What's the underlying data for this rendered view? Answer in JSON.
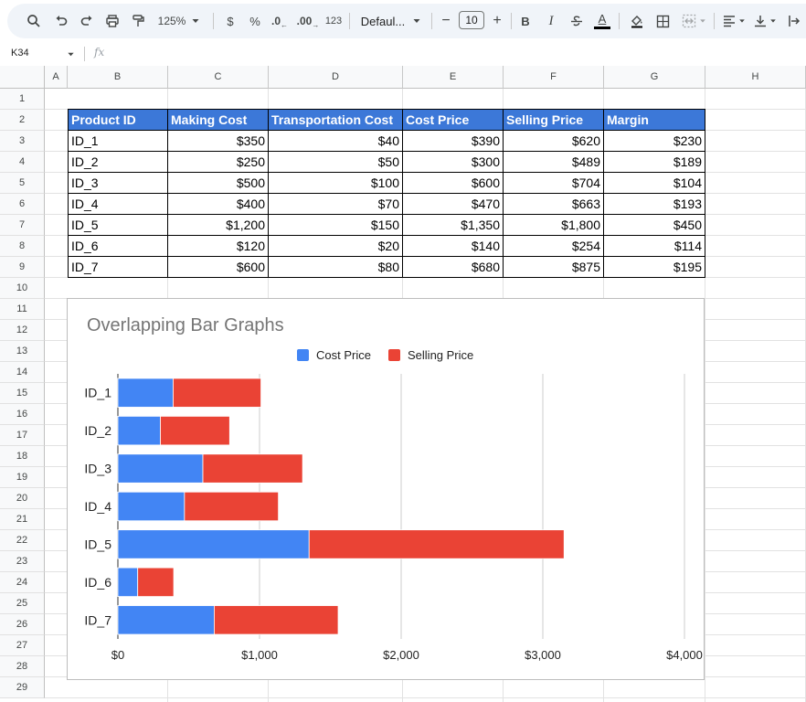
{
  "toolbar": {
    "zoom": "125%",
    "currency": "$",
    "percent": "%",
    "decrease_decimal": ".0",
    "increase_decimal": ".00",
    "number_format": "123",
    "font": "Defaul...",
    "font_size": "10",
    "bold": "B",
    "italic": "I",
    "text_color": "A",
    "accent_color": "#1a73e8"
  },
  "formula_bar": {
    "cell_ref": "K34",
    "fx": "fx",
    "formula": ""
  },
  "columns": [
    "A",
    "B",
    "C",
    "D",
    "E",
    "F",
    "G",
    "H"
  ],
  "rows": [
    "1",
    "2",
    "3",
    "4",
    "5",
    "6",
    "7",
    "8",
    "9",
    "10",
    "11",
    "12",
    "13",
    "14",
    "15",
    "16",
    "17",
    "18",
    "19",
    "20",
    "21",
    "22",
    "23",
    "24",
    "25",
    "26",
    "27",
    "28",
    "29"
  ],
  "table": {
    "headers": [
      "Product ID",
      "Making Cost",
      "Transportation Cost",
      "Cost Price",
      "Selling Price",
      "Margin"
    ],
    "header_color": "#3c78d8",
    "rows": [
      [
        "ID_1",
        "$350",
        "$40",
        "$390",
        "$620",
        "$230"
      ],
      [
        "ID_2",
        "$250",
        "$50",
        "$300",
        "$489",
        "$189"
      ],
      [
        "ID_3",
        "$500",
        "$100",
        "$600",
        "$704",
        "$104"
      ],
      [
        "ID_4",
        "$400",
        "$70",
        "$470",
        "$663",
        "$193"
      ],
      [
        "ID_5",
        "$1,200",
        "$150",
        "$1,350",
        "$1,800",
        "$450"
      ],
      [
        "ID_6",
        "$120",
        "$20",
        "$140",
        "$254",
        "$114"
      ],
      [
        "ID_7",
        "$600",
        "$80",
        "$680",
        "$875",
        "$195"
      ]
    ]
  },
  "chart_data": {
    "type": "bar",
    "orientation": "horizontal",
    "stacked": true,
    "title": "Overlapping Bar Graphs",
    "categories": [
      "ID_1",
      "ID_2",
      "ID_3",
      "ID_4",
      "ID_5",
      "ID_6",
      "ID_7"
    ],
    "series": [
      {
        "name": "Cost Price",
        "color": "#4285f4",
        "values": [
          390,
          300,
          600,
          470,
          1350,
          140,
          680
        ]
      },
      {
        "name": "Selling Price",
        "color": "#ea4335",
        "values": [
          620,
          489,
          704,
          663,
          1800,
          254,
          875
        ]
      }
    ],
    "xlim": [
      0,
      4000
    ],
    "xticks": [
      0,
      1000,
      2000,
      3000,
      4000
    ],
    "xtick_labels": [
      "$0",
      "$1,000",
      "$2,000",
      "$3,000",
      "$4,000"
    ],
    "xlabel": "",
    "ylabel": "",
    "grid": true,
    "legend": "top"
  }
}
